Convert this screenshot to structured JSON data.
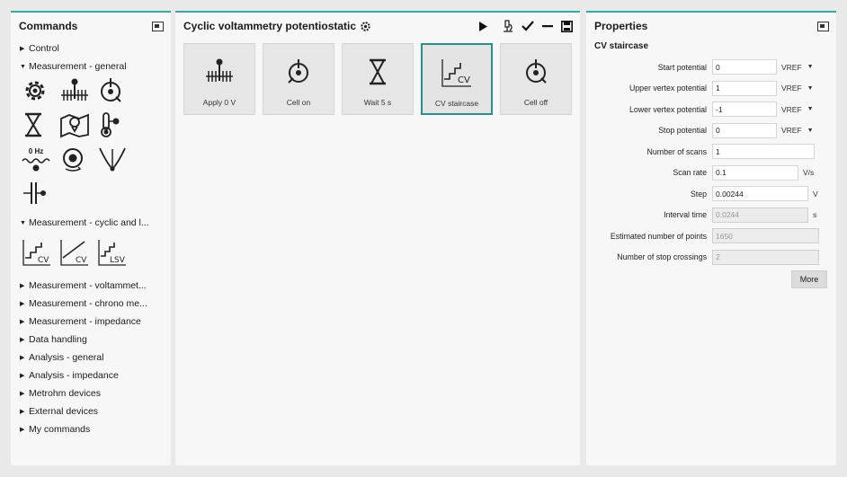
{
  "commands": {
    "title": "Commands",
    "control": "Control",
    "measurement_general": "Measurement - general",
    "measurement_general_icons": [
      "settings-icon",
      "apply-potential-icon",
      "cell-switch-icon",
      "wait-hourglass-icon",
      "map-pin-icon",
      "thermometer-icon",
      "frequency-icon",
      "stir-icon",
      "electrode-icon",
      "cell-connector-icon"
    ],
    "zero_hz": "0 Hz",
    "measurement_cyclic": "Measurement - cyclic and l...",
    "cyclic_icon_labels": [
      "CV",
      "CV",
      "LSV"
    ],
    "categories": [
      "Measurement - voltammet...",
      "Measurement - chrono me...",
      "Measurement - impedance",
      "Data handling",
      "Analysis - general",
      "Analysis - impedance",
      "Metrohm devices",
      "External devices",
      "My commands"
    ]
  },
  "procedure": {
    "title": "Cyclic voltammetry potentiostatic",
    "steps": [
      {
        "label": "Apply 0 V",
        "icon": "apply-potential-icon"
      },
      {
        "label": "Cell on",
        "icon": "cell-on-icon"
      },
      {
        "label": "Wait 5 s",
        "icon": "hourglass-icon"
      },
      {
        "label": "CV staircase",
        "icon": "cv-staircase-icon",
        "selected": true,
        "icon_text": "CV"
      },
      {
        "label": "Cell off",
        "icon": "cell-off-icon"
      }
    ]
  },
  "properties": {
    "title": "Properties",
    "subtitle": "CV staircase",
    "fields": [
      {
        "label": "Start potential",
        "value": "0",
        "unit": "VREF",
        "dropdown": true
      },
      {
        "label": "Upper vertex potential",
        "value": "1",
        "unit": "VREF",
        "dropdown": true
      },
      {
        "label": "Lower vertex potential",
        "value": "-1",
        "unit": "VREF",
        "dropdown": true
      },
      {
        "label": "Stop potential",
        "value": "0",
        "unit": "VREF",
        "dropdown": true
      },
      {
        "label": "Number of scans",
        "value": "1",
        "unit": ""
      },
      {
        "label": "Scan rate",
        "value": "0.1",
        "unit": "V/s"
      },
      {
        "label": "Step",
        "value": "0.00244",
        "unit": "V"
      },
      {
        "label": "Interval time",
        "value": "0.0244",
        "unit": "s",
        "readonly": true
      },
      {
        "label": "Estimated number of points",
        "value": "1650",
        "unit": "",
        "readonly": true
      },
      {
        "label": "Number of stop crossings",
        "value": "2",
        "unit": "",
        "readonly": true
      }
    ],
    "more_button": "More"
  },
  "colors": {
    "accent": "#3aa6a0",
    "selected_border": "#2a8f8a"
  }
}
